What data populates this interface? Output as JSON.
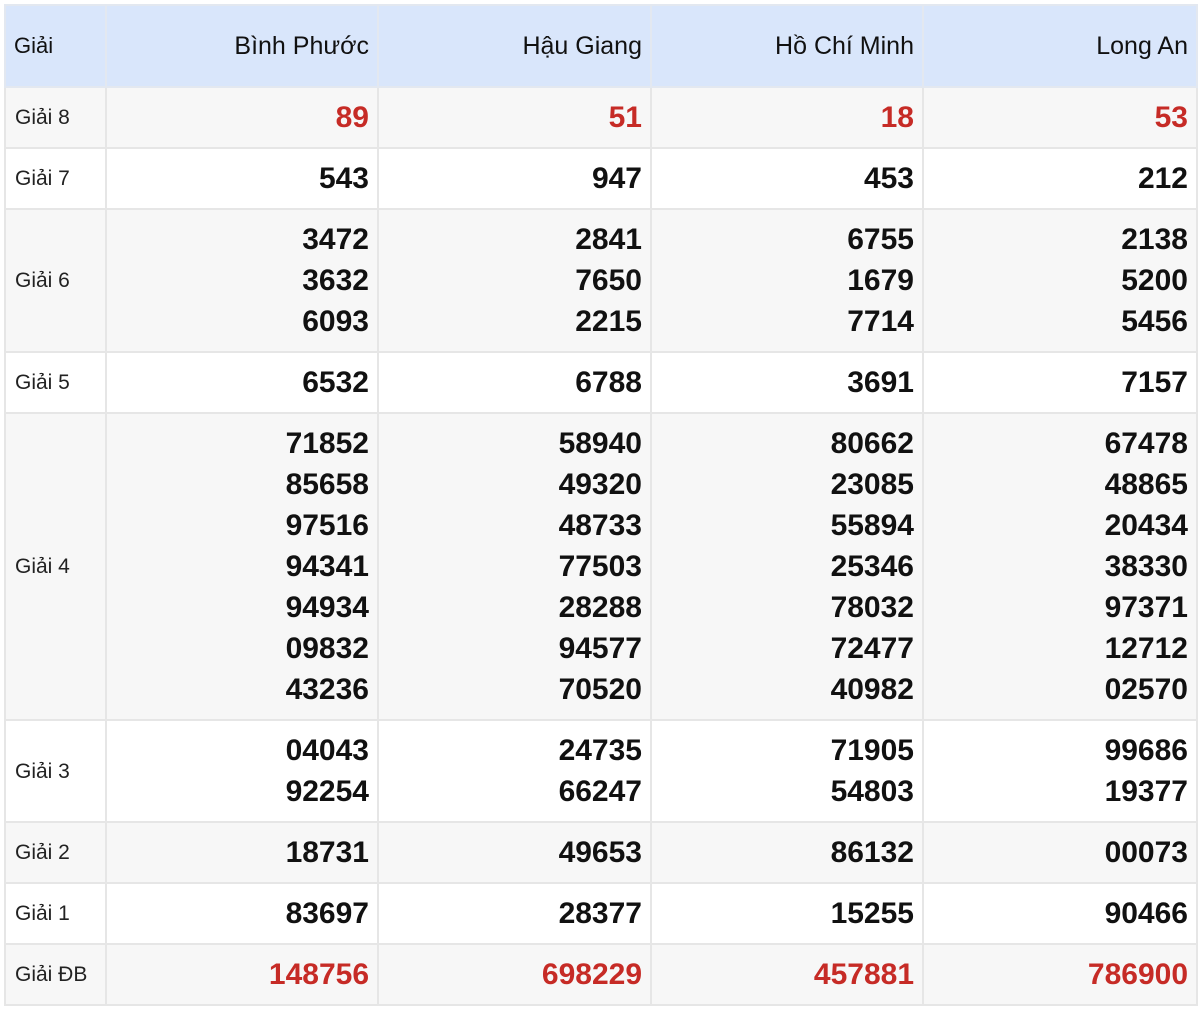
{
  "header": {
    "label": "Giải",
    "columns": [
      "Bình Phước",
      "Hậu Giang",
      "Hồ Chí Minh",
      "Long An"
    ]
  },
  "prizes": [
    {
      "label": "Giải 8",
      "highlight": true,
      "values": [
        [
          "89"
        ],
        [
          "51"
        ],
        [
          "18"
        ],
        [
          "53"
        ]
      ]
    },
    {
      "label": "Giải 7",
      "values": [
        [
          "543"
        ],
        [
          "947"
        ],
        [
          "453"
        ],
        [
          "212"
        ]
      ]
    },
    {
      "label": "Giải 6",
      "values": [
        [
          "3472",
          "3632",
          "6093"
        ],
        [
          "2841",
          "7650",
          "2215"
        ],
        [
          "6755",
          "1679",
          "7714"
        ],
        [
          "2138",
          "5200",
          "5456"
        ]
      ]
    },
    {
      "label": "Giải 5",
      "values": [
        [
          "6532"
        ],
        [
          "6788"
        ],
        [
          "3691"
        ],
        [
          "7157"
        ]
      ]
    },
    {
      "label": "Giải 4",
      "values": [
        [
          "71852",
          "85658",
          "97516",
          "94341",
          "94934",
          "09832",
          "43236"
        ],
        [
          "58940",
          "49320",
          "48733",
          "77503",
          "28288",
          "94577",
          "70520"
        ],
        [
          "80662",
          "23085",
          "55894",
          "25346",
          "78032",
          "72477",
          "40982"
        ],
        [
          "67478",
          "48865",
          "20434",
          "38330",
          "97371",
          "12712",
          "02570"
        ]
      ]
    },
    {
      "label": "Giải 3",
      "values": [
        [
          "04043",
          "92254"
        ],
        [
          "24735",
          "66247"
        ],
        [
          "71905",
          "54803"
        ],
        [
          "99686",
          "19377"
        ]
      ]
    },
    {
      "label": "Giải 2",
      "values": [
        [
          "18731"
        ],
        [
          "49653"
        ],
        [
          "86132"
        ],
        [
          "00073"
        ]
      ]
    },
    {
      "label": "Giải 1",
      "values": [
        [
          "83697"
        ],
        [
          "28377"
        ],
        [
          "15255"
        ],
        [
          "90466"
        ]
      ]
    },
    {
      "label": "Giải ĐB",
      "highlight": true,
      "values": [
        [
          "148756"
        ],
        [
          "698229"
        ],
        [
          "457881"
        ],
        [
          "786900"
        ]
      ]
    }
  ],
  "colors": {
    "header_bg": "#d9e6fb",
    "highlight_number": "#c62b26",
    "shaded_row": "#f7f7f7",
    "border": "#e6e6e6"
  }
}
